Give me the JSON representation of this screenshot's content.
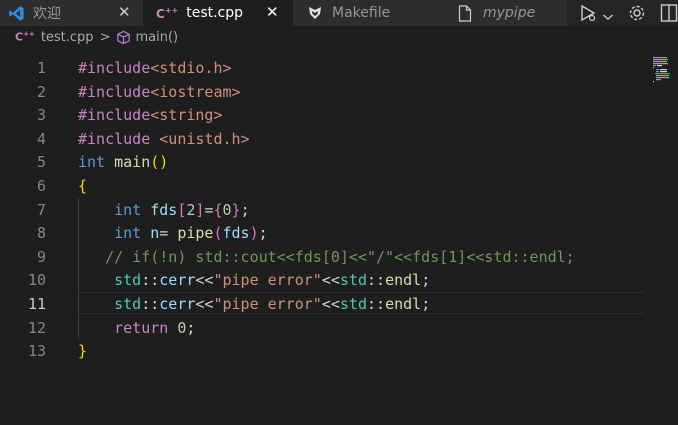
{
  "tabs": [
    {
      "label": "欢迎",
      "icon": "vscode-logo-icon",
      "state": "inactive",
      "close": "✕"
    },
    {
      "label": "test.cpp",
      "icon": "cpp-file-icon",
      "state": "active",
      "close": "✕"
    },
    {
      "label": "Makefile",
      "icon": "makefile-icon",
      "state": "inactive"
    },
    {
      "label": "mypipe",
      "icon": "file-icon",
      "state": "inactive"
    }
  ],
  "actions": [
    {
      "name": "run-debug-icon"
    },
    {
      "name": "chevron-down-icon"
    },
    {
      "name": "gear-icon"
    },
    {
      "name": "split-editor-icon"
    }
  ],
  "breadcrumb": {
    "file": "test.cpp",
    "separator": ">",
    "symbol": "main()"
  },
  "editor": {
    "current_line": 11,
    "line_numbers": [
      "1",
      "2",
      "3",
      "4",
      "5",
      "6",
      "7",
      "8",
      "9",
      "10",
      "11",
      "12",
      "13"
    ],
    "colors": {
      "preprocessor": "#c586c0",
      "include_path": "#ce9178",
      "keyword": "#569cd6",
      "function": "#dcdcaa",
      "variable": "#9cdcfe",
      "number": "#b5cea8",
      "string": "#ce9178",
      "comment": "#6a9955",
      "namespace": "#4ec9b0"
    },
    "lines": [
      [
        {
          "t": "#include",
          "c": "t-pp"
        },
        {
          "t": "<stdio.h>",
          "c": "t-inc"
        }
      ],
      [
        {
          "t": "#include",
          "c": "t-pp"
        },
        {
          "t": "<iostream>",
          "c": "t-inc"
        }
      ],
      [
        {
          "t": "#include",
          "c": "t-pp"
        },
        {
          "t": "<string>",
          "c": "t-inc"
        }
      ],
      [
        {
          "t": "#include ",
          "c": "t-pp"
        },
        {
          "t": "<unistd.h>",
          "c": "t-inc"
        }
      ],
      [
        {
          "t": "int",
          "c": "t-kw"
        },
        {
          "t": " ",
          "c": "t-op"
        },
        {
          "t": "main",
          "c": "t-fn"
        },
        {
          "t": "()",
          "c": "t-b1"
        }
      ],
      [
        {
          "t": "{",
          "c": "t-b1"
        }
      ],
      [
        {
          "t": "    ",
          "c": "t-op"
        },
        {
          "t": "int",
          "c": "t-kw"
        },
        {
          "t": " ",
          "c": "t-op"
        },
        {
          "t": "fds",
          "c": "t-var"
        },
        {
          "t": "[",
          "c": "t-b2"
        },
        {
          "t": "2",
          "c": "t-num"
        },
        {
          "t": "]",
          "c": "t-b2"
        },
        {
          "t": "=",
          "c": "t-op"
        },
        {
          "t": "{",
          "c": "t-b2"
        },
        {
          "t": "0",
          "c": "t-num"
        },
        {
          "t": "}",
          "c": "t-b2"
        },
        {
          "t": ";",
          "c": "t-op"
        }
      ],
      [
        {
          "t": "    ",
          "c": "t-op"
        },
        {
          "t": "int",
          "c": "t-kw"
        },
        {
          "t": " ",
          "c": "t-op"
        },
        {
          "t": "n",
          "c": "t-var"
        },
        {
          "t": "= ",
          "c": "t-op"
        },
        {
          "t": "pipe",
          "c": "t-fn"
        },
        {
          "t": "(",
          "c": "t-b2"
        },
        {
          "t": "fds",
          "c": "t-var"
        },
        {
          "t": ")",
          "c": "t-b2"
        },
        {
          "t": ";",
          "c": "t-op"
        }
      ],
      [
        {
          "t": "   ",
          "c": "t-op"
        },
        {
          "t": "// if(!n) std::cout<<fds[0]<<\"/\"<<fds[1]<<std::endl;",
          "c": "t-cm"
        }
      ],
      [
        {
          "t": "    ",
          "c": "t-op"
        },
        {
          "t": "std",
          "c": "t-ns"
        },
        {
          "t": "::",
          "c": "t-op"
        },
        {
          "t": "cerr",
          "c": "t-var"
        },
        {
          "t": "<<",
          "c": "t-op"
        },
        {
          "t": "\"pipe error\"",
          "c": "t-str"
        },
        {
          "t": "<<",
          "c": "t-op"
        },
        {
          "t": "std",
          "c": "t-ns"
        },
        {
          "t": "::",
          "c": "t-op"
        },
        {
          "t": "endl",
          "c": "t-fn"
        },
        {
          "t": ";",
          "c": "t-op"
        }
      ],
      [
        {
          "t": "    ",
          "c": "t-op"
        },
        {
          "t": "std",
          "c": "t-ns"
        },
        {
          "t": "::",
          "c": "t-op"
        },
        {
          "t": "cerr",
          "c": "t-var"
        },
        {
          "t": "<<",
          "c": "t-op"
        },
        {
          "t": "\"pipe error\"",
          "c": "t-str"
        },
        {
          "t": "<<",
          "c": "t-op"
        },
        {
          "t": "std",
          "c": "t-ns"
        },
        {
          "t": "::",
          "c": "t-op"
        },
        {
          "t": "endl",
          "c": "t-fn"
        },
        {
          "t": ";",
          "c": "t-op"
        }
      ],
      [
        {
          "t": "    ",
          "c": "t-op"
        },
        {
          "t": "return",
          "c": "t-ctl"
        },
        {
          "t": " ",
          "c": "t-op"
        },
        {
          "t": "0",
          "c": "t-num"
        },
        {
          "t": ";",
          "c": "t-op"
        }
      ],
      [
        {
          "t": "}",
          "c": "t-b1"
        }
      ]
    ]
  }
}
